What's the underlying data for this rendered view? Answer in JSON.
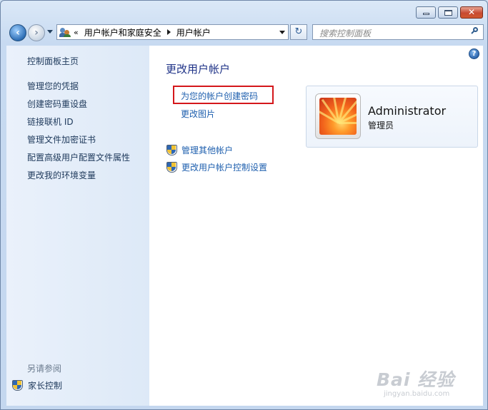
{
  "titlebar": {
    "minimize_glyph": "",
    "maximize_glyph": "",
    "close_glyph": "✕"
  },
  "nav": {
    "breadcrumb_overflow": "«",
    "breadcrumb": [
      "用户帐户和家庭安全",
      "用户帐户"
    ],
    "refresh_glyph": "↻",
    "search_placeholder": "搜索控制面板"
  },
  "sidebar": {
    "home_label": "控制面板主页",
    "links": [
      "管理您的凭据",
      "创建密码重设盘",
      "链接联机 ID",
      "管理文件加密证书",
      "配置高级用户配置文件属性",
      "更改我的环境变量"
    ],
    "see_also_label": "另请参阅",
    "parental_controls_label": "家长控制"
  },
  "main": {
    "heading": "更改用户帐户",
    "create_password_link": "为您的帐户创建密码",
    "change_picture_link": "更改图片",
    "manage_other_accounts_link": "管理其他帐户",
    "uac_settings_link": "更改用户帐户控制设置",
    "help_glyph": "?",
    "highlight_color": "#d4171b"
  },
  "account": {
    "name": "Administrator",
    "role": "管理员"
  },
  "watermark": {
    "text": "Bai 经验",
    "url": "jingyan.baidu.com"
  }
}
